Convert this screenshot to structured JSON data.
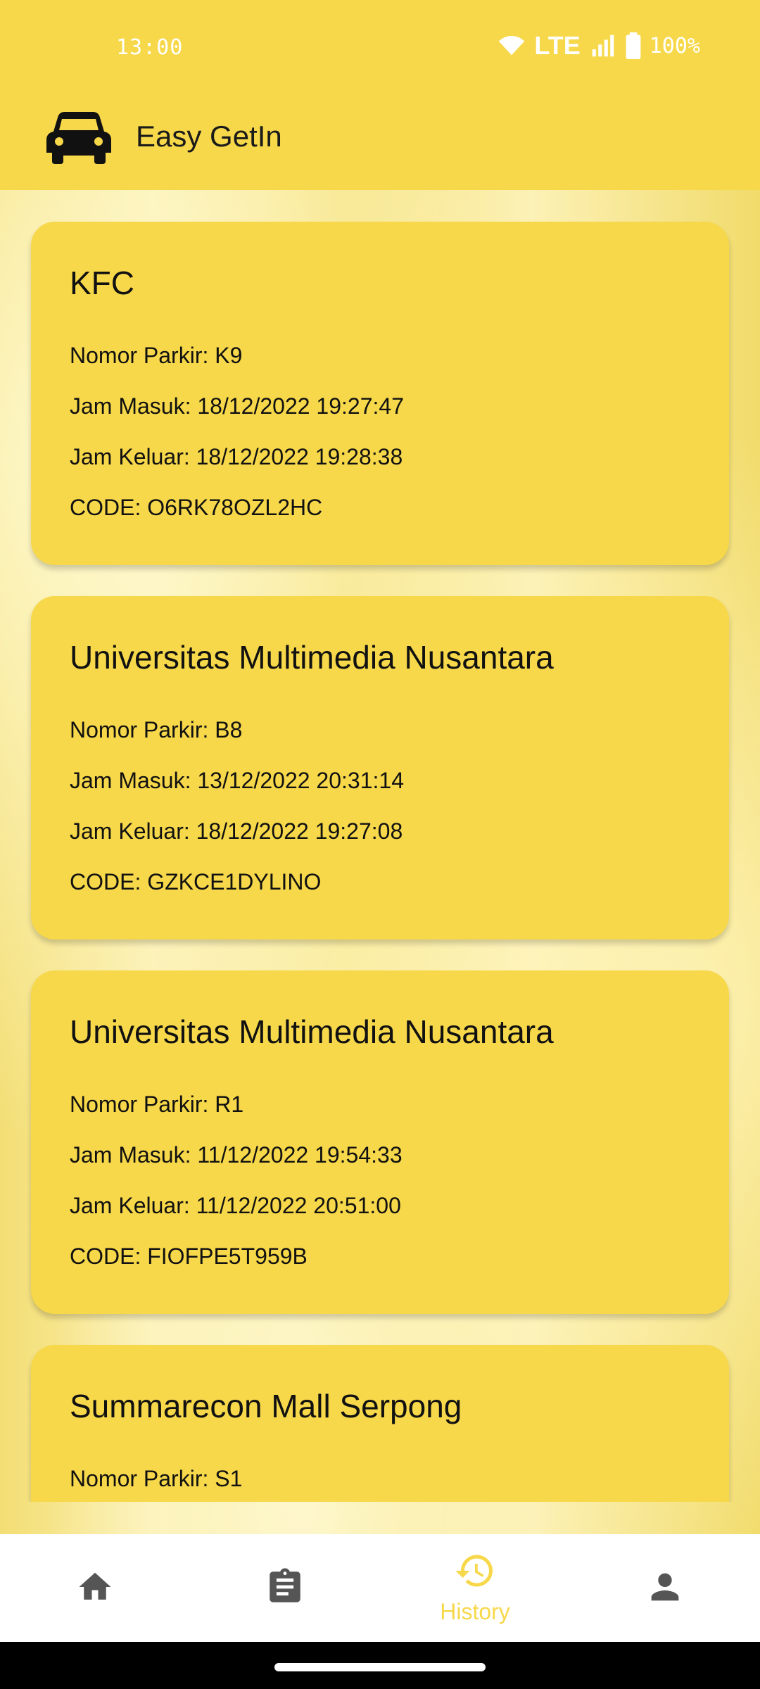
{
  "status_bar": {
    "time": "13:00",
    "network": "LTE",
    "battery": "100%",
    "icons": [
      "wifi-icon",
      "signal-icon",
      "battery-icon"
    ]
  },
  "app_bar": {
    "icon": "car-icon",
    "title": "Easy GetIn"
  },
  "history": [
    {
      "place": "KFC",
      "nomor_parkir": "Nomor Parkir: K9",
      "jam_masuk": "Jam Masuk: 18/12/2022 19:27:47",
      "jam_keluar": "Jam Keluar: 18/12/2022 19:28:38",
      "code": "CODE: O6RK78OZL2HC"
    },
    {
      "place": "Universitas Multimedia Nusantara",
      "nomor_parkir": "Nomor Parkir: B8",
      "jam_masuk": "Jam Masuk: 13/12/2022 20:31:14",
      "jam_keluar": "Jam Keluar: 18/12/2022 19:27:08",
      "code": "CODE: GZKCE1DYLINO"
    },
    {
      "place": "Universitas Multimedia Nusantara",
      "nomor_parkir": "Nomor Parkir: R1",
      "jam_masuk": "Jam Masuk: 11/12/2022 19:54:33",
      "jam_keluar": "Jam Keluar: 11/12/2022 20:51:00",
      "code": "CODE: FIOFPE5T959B"
    },
    {
      "place": "Summarecon Mall Serpong",
      "nomor_parkir": "Nomor Parkir: S1"
    }
  ],
  "bottom_nav": {
    "items": [
      {
        "icon": "home-icon",
        "label": "",
        "active": false
      },
      {
        "icon": "clipboard-icon",
        "label": "",
        "active": false
      },
      {
        "icon": "history-icon",
        "label": "History",
        "active": true
      },
      {
        "icon": "person-icon",
        "label": "",
        "active": false
      }
    ],
    "active_color": "#f7d84a",
    "inactive_color": "#555555"
  },
  "colors": {
    "primary": "#f7d84a",
    "card": "#f7d84a",
    "text": "#111111"
  }
}
